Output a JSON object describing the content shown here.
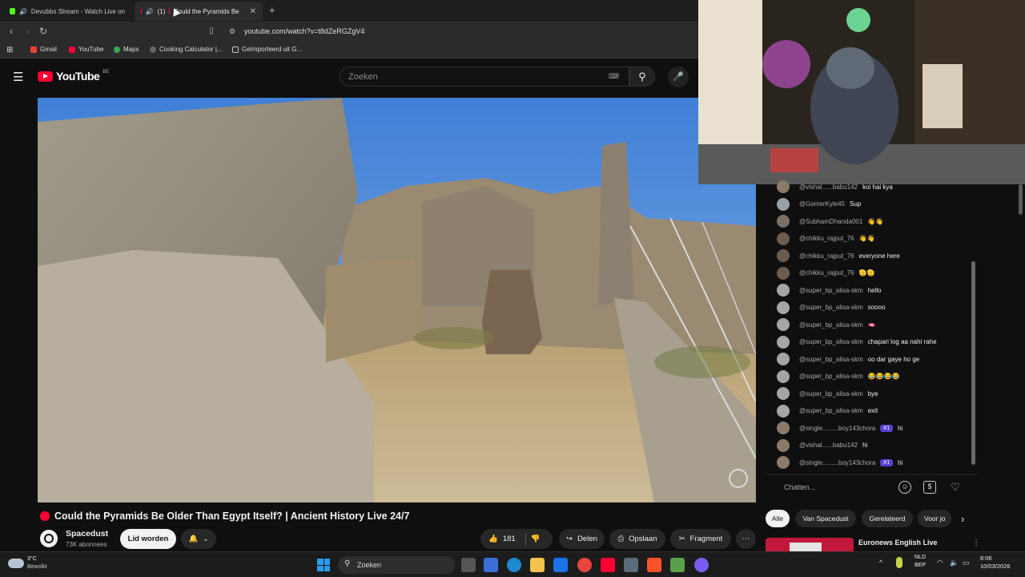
{
  "browser": {
    "tabs": [
      {
        "label": "Devubbs Stream - Watch Live on"
      },
      {
        "label": "(1)",
        "title": "Could the Pyramids Be"
      }
    ],
    "url": "youtube.com/watch?v=t8dZeRGZgV4",
    "bookmarks": [
      "Gmail",
      "YouTube",
      "Maps",
      "Cooking Calculator |...",
      "Geïmporteerd uit G..."
    ]
  },
  "youtube": {
    "logo": "YouTube",
    "region": "BE",
    "search_placeholder": "Zoeken"
  },
  "video": {
    "title": "Could the Pyramids Be Older Than Egypt Itself? | Ancient History Live 24/7",
    "channel": "Spacedust",
    "subscribers": "73K abonnees",
    "join_label": "Lid worden",
    "likes": "181",
    "share_label": "Delen",
    "save_label": "Opslaan",
    "clip_label": "Fragment"
  },
  "chat": {
    "messages": [
      {
        "author": "@vishal......babu142",
        "text": "koi hai kya"
      },
      {
        "author": "@GomerKyle45",
        "text": "Sup"
      },
      {
        "author": "@SubhamDhanda001",
        "text": "👋👋"
      },
      {
        "author": "@chikku_rajput_76",
        "text": "👋👋"
      },
      {
        "author": "@chikku_rajput_76",
        "text": "everyone here"
      },
      {
        "author": "@chikku_rajput_76",
        "text": "🫡🫡"
      },
      {
        "author": "@super_bp_alisa-skm",
        "text": "hello"
      },
      {
        "author": "@super_bp_alisa-skm",
        "text": "soooo"
      },
      {
        "author": "@super_bp_alisa-skm",
        "text": "🫦"
      },
      {
        "author": "@super_bp_alisa-skm",
        "text": "chapari log aa nahi rahe"
      },
      {
        "author": "@super_bp_alisa-skm",
        "text": "oo dar gaye ho ge"
      },
      {
        "author": "@super_bp_alisa-skm",
        "text": "😂😂😂😂"
      },
      {
        "author": "@super_bp_alisa-skm",
        "text": "bye"
      },
      {
        "author": "@super_bp_alisa-skm",
        "text": "exit"
      },
      {
        "author": "@single.........boy143chora",
        "badge": "#1",
        "text": "hi"
      },
      {
        "author": "@vishal......babu142",
        "text": "hi"
      },
      {
        "author": "@single.........boy143chora",
        "badge": "#1",
        "text": "hi"
      }
    ],
    "input_placeholder": "Chatten..."
  },
  "chips": [
    "Alle",
    "Van Spacedust",
    "Gerelateerd",
    "Voor jo"
  ],
  "sidebar_video": {
    "title": "Euronews English Live"
  },
  "taskbar": {
    "weather_temp": "3°C",
    "weather_desc": "Bewolkt",
    "search_label": "Zoeken",
    "lang_top": "NLD",
    "lang_bottom": "BEP",
    "time": "8:06",
    "date": "10/03/2026"
  },
  "colors": {
    "accent_red": "#ff0033",
    "background": "#0f0f0f",
    "badge_purple": "#5b3fd8"
  }
}
